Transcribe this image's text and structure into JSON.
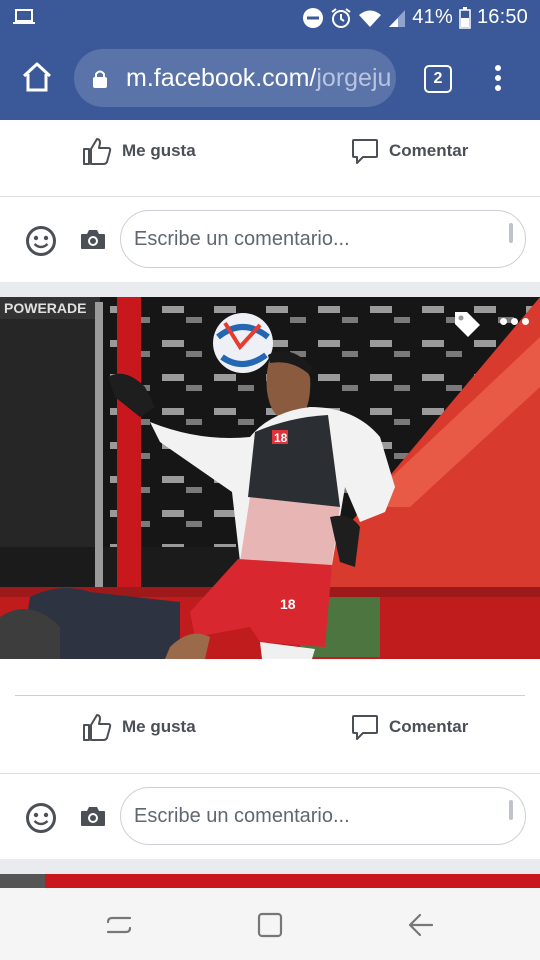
{
  "status_bar": {
    "battery": "41%",
    "time": "16:50"
  },
  "browser": {
    "url_domain": "m.facebook.com/",
    "url_path": "jorgeju",
    "tab_count": "2"
  },
  "post1": {
    "like_label": "Me gusta",
    "comment_label": "Comentar",
    "comment_placeholder": "Escribe un comentario..."
  },
  "post2": {
    "like_label": "Me gusta",
    "comment_label": "Comentar",
    "comment_placeholder": "Escribe un comentario...",
    "photo_texts": {
      "banner": "POWERADE",
      "jersey_number": "18",
      "shorts_number": "18",
      "sponsor_tile": "POWER ADE"
    }
  },
  "colors": {
    "facebook_blue": "#3b5998",
    "url_pill": "#5a73a8",
    "action_text": "#4b4f56",
    "background": "#e9ebee"
  },
  "icons": {
    "status": [
      "laptop-icon",
      "do-not-disturb-icon",
      "alarm-icon",
      "wifi-icon",
      "signal-icon",
      "battery-icon"
    ],
    "browser": [
      "home-icon",
      "lock-icon",
      "tabs-icon",
      "menu-icon"
    ],
    "post": [
      "like-icon",
      "comment-icon",
      "emoji-icon",
      "camera-icon",
      "tag-icon",
      "more-icon"
    ],
    "nav": [
      "recent-apps-icon",
      "home-button-icon",
      "back-icon"
    ]
  }
}
